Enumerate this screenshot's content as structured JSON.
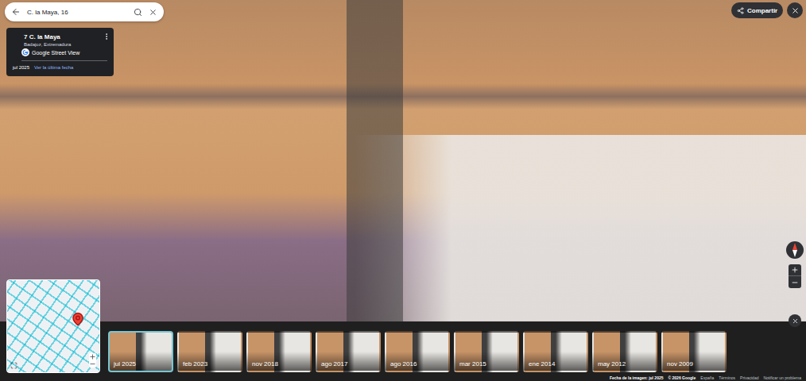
{
  "search": {
    "query": "C. la Maya, 16"
  },
  "info_card": {
    "title": "7 C. la Maya",
    "subtitle": "Badajoz, Extremadura",
    "source": "Google Street View",
    "date": "jul 2025",
    "link": "Ver la última fecha"
  },
  "share_button": {
    "label": "Compartir"
  },
  "timeline": [
    {
      "label": "jul 2025",
      "selected": true
    },
    {
      "label": "feb 2023",
      "selected": false
    },
    {
      "label": "nov 2018",
      "selected": false
    },
    {
      "label": "ago 2017",
      "selected": false
    },
    {
      "label": "ago 2016",
      "selected": false
    },
    {
      "label": "mar 2015",
      "selected": false
    },
    {
      "label": "ene 2014",
      "selected": false
    },
    {
      "label": "may 2012",
      "selected": false
    },
    {
      "label": "nov 2009",
      "selected": false
    }
  ],
  "footer": {
    "date": "Fecha de la imagen: jul 2025",
    "copyright": "© 2026 Google",
    "links": [
      "España",
      "Términos",
      "Privacidad",
      "Notificar un problema"
    ]
  }
}
